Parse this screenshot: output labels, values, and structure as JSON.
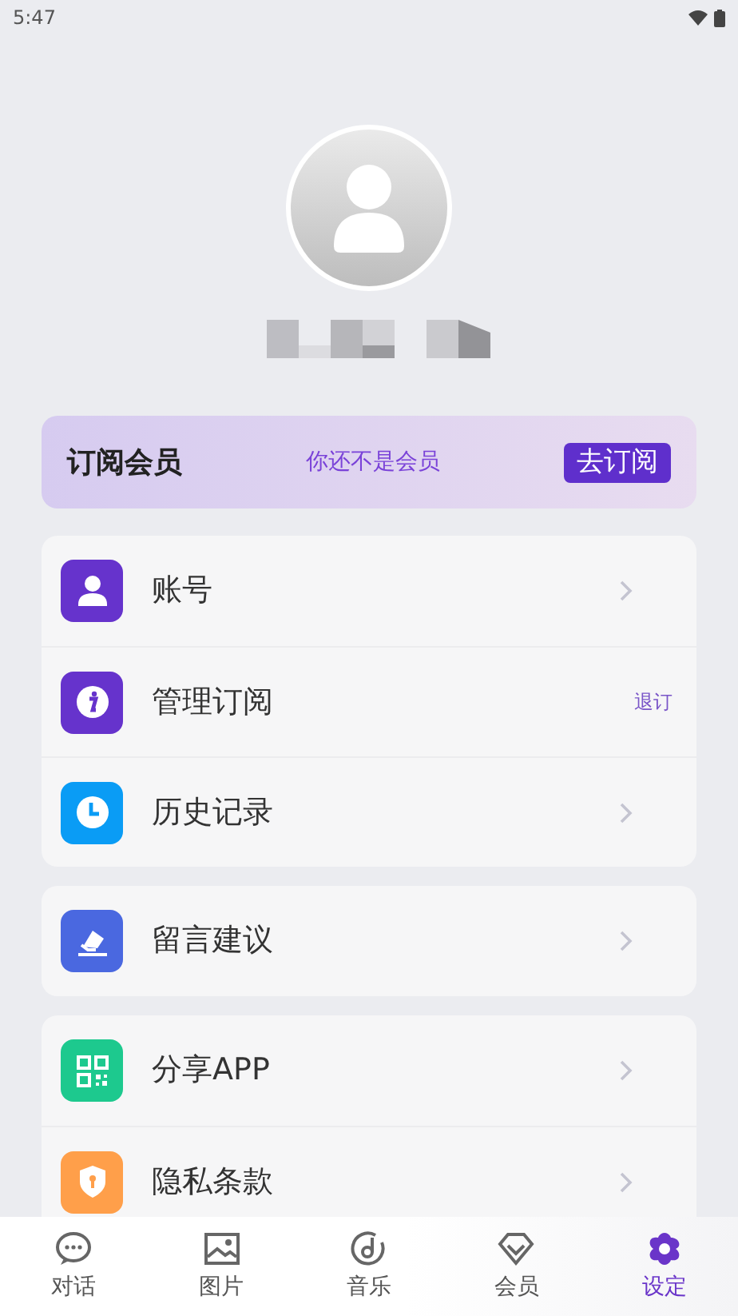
{
  "status_bar": {
    "time": "5:47"
  },
  "membership_banner": {
    "title": "订阅会员",
    "status": "你还不是会员",
    "button": "去订阅"
  },
  "groups": [
    {
      "items": [
        {
          "label": "账号",
          "color": "#6633cc"
        },
        {
          "label": "管理订阅",
          "color": "#6633cc",
          "trailing": "退订"
        },
        {
          "label": "历史记录",
          "color": "#0a9cf5"
        }
      ]
    },
    {
      "items": [
        {
          "label": "留言建议",
          "color": "#4a68e0"
        }
      ]
    },
    {
      "items": [
        {
          "label": "分享APP",
          "color": "#1dc98e"
        },
        {
          "label": "隐私条款",
          "color": "#ff9f4a"
        }
      ]
    }
  ],
  "tab_bar": [
    {
      "label": "对话",
      "selected": false
    },
    {
      "label": "图片",
      "selected": false
    },
    {
      "label": "音乐",
      "selected": false
    },
    {
      "label": "会员",
      "selected": false
    },
    {
      "label": "设定",
      "selected": true
    }
  ]
}
